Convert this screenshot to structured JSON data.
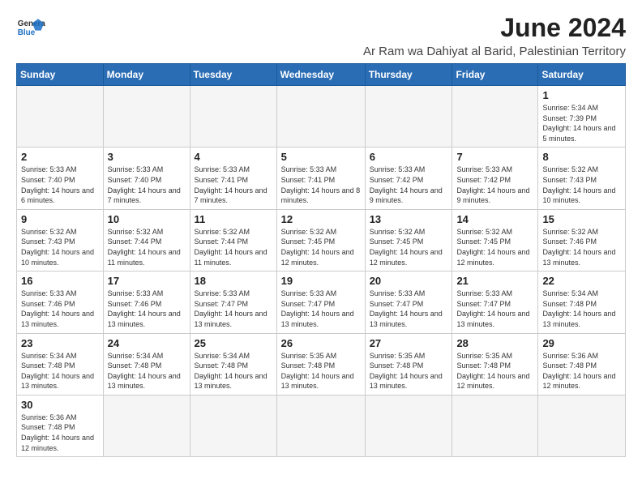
{
  "header": {
    "logo_general": "General",
    "logo_blue": "Blue",
    "month_title": "June 2024",
    "subtitle": "Ar Ram wa Dahiyat al Barid, Palestinian Territory"
  },
  "days_of_week": [
    "Sunday",
    "Monday",
    "Tuesday",
    "Wednesday",
    "Thursday",
    "Friday",
    "Saturday"
  ],
  "weeks": [
    [
      {
        "day": null,
        "info": null
      },
      {
        "day": null,
        "info": null
      },
      {
        "day": null,
        "info": null
      },
      {
        "day": null,
        "info": null
      },
      {
        "day": null,
        "info": null
      },
      {
        "day": null,
        "info": null
      },
      {
        "day": "1",
        "info": "Sunrise: 5:34 AM\nSunset: 7:39 PM\nDaylight: 14 hours and 5 minutes."
      }
    ],
    [
      {
        "day": "2",
        "info": "Sunrise: 5:33 AM\nSunset: 7:40 PM\nDaylight: 14 hours and 6 minutes."
      },
      {
        "day": "3",
        "info": "Sunrise: 5:33 AM\nSunset: 7:40 PM\nDaylight: 14 hours and 7 minutes."
      },
      {
        "day": "4",
        "info": "Sunrise: 5:33 AM\nSunset: 7:41 PM\nDaylight: 14 hours and 7 minutes."
      },
      {
        "day": "5",
        "info": "Sunrise: 5:33 AM\nSunset: 7:41 PM\nDaylight: 14 hours and 8 minutes."
      },
      {
        "day": "6",
        "info": "Sunrise: 5:33 AM\nSunset: 7:42 PM\nDaylight: 14 hours and 9 minutes."
      },
      {
        "day": "7",
        "info": "Sunrise: 5:33 AM\nSunset: 7:42 PM\nDaylight: 14 hours and 9 minutes."
      },
      {
        "day": "8",
        "info": "Sunrise: 5:32 AM\nSunset: 7:43 PM\nDaylight: 14 hours and 10 minutes."
      }
    ],
    [
      {
        "day": "9",
        "info": "Sunrise: 5:32 AM\nSunset: 7:43 PM\nDaylight: 14 hours and 10 minutes."
      },
      {
        "day": "10",
        "info": "Sunrise: 5:32 AM\nSunset: 7:44 PM\nDaylight: 14 hours and 11 minutes."
      },
      {
        "day": "11",
        "info": "Sunrise: 5:32 AM\nSunset: 7:44 PM\nDaylight: 14 hours and 11 minutes."
      },
      {
        "day": "12",
        "info": "Sunrise: 5:32 AM\nSunset: 7:45 PM\nDaylight: 14 hours and 12 minutes."
      },
      {
        "day": "13",
        "info": "Sunrise: 5:32 AM\nSunset: 7:45 PM\nDaylight: 14 hours and 12 minutes."
      },
      {
        "day": "14",
        "info": "Sunrise: 5:32 AM\nSunset: 7:45 PM\nDaylight: 14 hours and 12 minutes."
      },
      {
        "day": "15",
        "info": "Sunrise: 5:32 AM\nSunset: 7:46 PM\nDaylight: 14 hours and 13 minutes."
      }
    ],
    [
      {
        "day": "16",
        "info": "Sunrise: 5:33 AM\nSunset: 7:46 PM\nDaylight: 14 hours and 13 minutes."
      },
      {
        "day": "17",
        "info": "Sunrise: 5:33 AM\nSunset: 7:46 PM\nDaylight: 14 hours and 13 minutes."
      },
      {
        "day": "18",
        "info": "Sunrise: 5:33 AM\nSunset: 7:47 PM\nDaylight: 14 hours and 13 minutes."
      },
      {
        "day": "19",
        "info": "Sunrise: 5:33 AM\nSunset: 7:47 PM\nDaylight: 14 hours and 13 minutes."
      },
      {
        "day": "20",
        "info": "Sunrise: 5:33 AM\nSunset: 7:47 PM\nDaylight: 14 hours and 13 minutes."
      },
      {
        "day": "21",
        "info": "Sunrise: 5:33 AM\nSunset: 7:47 PM\nDaylight: 14 hours and 13 minutes."
      },
      {
        "day": "22",
        "info": "Sunrise: 5:34 AM\nSunset: 7:48 PM\nDaylight: 14 hours and 13 minutes."
      }
    ],
    [
      {
        "day": "23",
        "info": "Sunrise: 5:34 AM\nSunset: 7:48 PM\nDaylight: 14 hours and 13 minutes."
      },
      {
        "day": "24",
        "info": "Sunrise: 5:34 AM\nSunset: 7:48 PM\nDaylight: 14 hours and 13 minutes."
      },
      {
        "day": "25",
        "info": "Sunrise: 5:34 AM\nSunset: 7:48 PM\nDaylight: 14 hours and 13 minutes."
      },
      {
        "day": "26",
        "info": "Sunrise: 5:35 AM\nSunset: 7:48 PM\nDaylight: 14 hours and 13 minutes."
      },
      {
        "day": "27",
        "info": "Sunrise: 5:35 AM\nSunset: 7:48 PM\nDaylight: 14 hours and 13 minutes."
      },
      {
        "day": "28",
        "info": "Sunrise: 5:35 AM\nSunset: 7:48 PM\nDaylight: 14 hours and 12 minutes."
      },
      {
        "day": "29",
        "info": "Sunrise: 5:36 AM\nSunset: 7:48 PM\nDaylight: 14 hours and 12 minutes."
      }
    ],
    [
      {
        "day": "30",
        "info": "Sunrise: 5:36 AM\nSunset: 7:48 PM\nDaylight: 14 hours and 12 minutes."
      },
      {
        "day": null,
        "info": null
      },
      {
        "day": null,
        "info": null
      },
      {
        "day": null,
        "info": null
      },
      {
        "day": null,
        "info": null
      },
      {
        "day": null,
        "info": null
      },
      {
        "day": null,
        "info": null
      }
    ]
  ]
}
